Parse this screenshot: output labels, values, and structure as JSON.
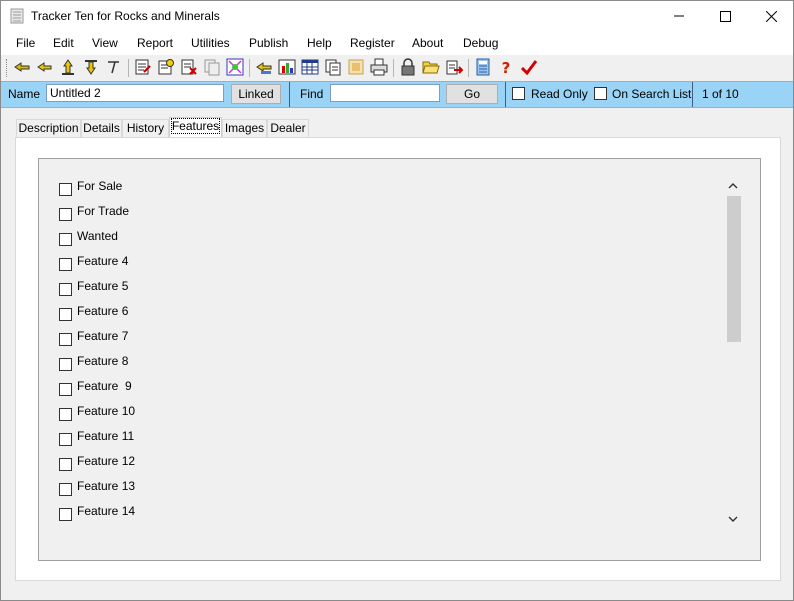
{
  "window": {
    "title": "Tracker Ten for Rocks and Minerals"
  },
  "menu": [
    "File",
    "Edit",
    "View",
    "Report",
    "Utilities",
    "Publish",
    "Help",
    "Register",
    "About",
    "Debug"
  ],
  "toolbar": {
    "icons": [
      "nav-first-icon",
      "nav-prev-icon",
      "nav-up-icon",
      "nav-down-icon",
      "nav-last-icon",
      "edit-record-icon",
      "new-record-icon",
      "delete-record-icon",
      "copy-record-icon",
      "search-icon",
      "open-list-icon",
      "chart-icon",
      "table-icon",
      "copy-icon",
      "image-icon",
      "print-icon",
      "lock-icon",
      "folder-open-icon",
      "export-icon",
      "calculator-icon",
      "help-icon",
      "checkmark-icon"
    ]
  },
  "namebar": {
    "name_label": "Name",
    "name_value": "Untitled 2",
    "linked_label": "Linked",
    "find_label": "Find",
    "find_value": "",
    "go_label": "Go",
    "readonly_label": "Read Only",
    "searchlist_label": "On Search List",
    "record_position": "1 of 10"
  },
  "tabs": [
    "Description",
    "Details",
    "History",
    "Features",
    "Images",
    "Dealer"
  ],
  "active_tab": "Features",
  "features": [
    "For Sale",
    "For Trade",
    "Wanted",
    "Feature 4",
    "Feature 5",
    "Feature 6",
    "Feature 7",
    "Feature 8",
    "Feature  9",
    "Feature 10",
    "Feature 11",
    "Feature 12",
    "Feature 13",
    "Feature 14"
  ],
  "colors": {
    "namebar": "#99d3f5",
    "accent_red": "#d40000"
  }
}
